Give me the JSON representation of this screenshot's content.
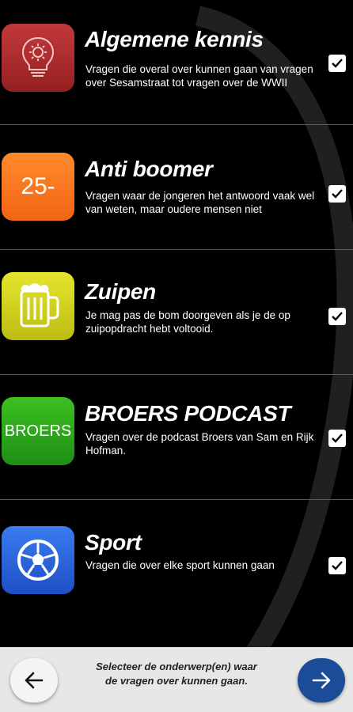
{
  "categories": [
    {
      "title": "Algemene kennis",
      "description": "Vragen die overal over kunnen gaan van vragen over Sesamstraat tot vragen over de WWII",
      "icon": "lightbulb-gear-icon",
      "color": "#b32b2e",
      "checked": true
    },
    {
      "title": "Anti boomer",
      "description": "Vragen waar de jongeren het antwoord vaak wel van weten, maar oudere mensen niet",
      "icon_text": "25-",
      "color": "#f77a1f",
      "checked": true
    },
    {
      "title": "Zuipen",
      "description": "Je mag pas de bom doorgeven als je de op zuipopdracht hebt voltooid.",
      "icon": "beer-mug-icon",
      "color": "#d6d61f",
      "checked": true
    },
    {
      "title": "BROERS PODCAST",
      "description": "Vragen over de podcast Broers van Sam en Rijk Hofman.",
      "icon_text": "BROERS",
      "color": "#2ea81c",
      "checked": true
    },
    {
      "title": "Sport",
      "description": "Vragen die over elke sport kunnen gaan",
      "icon": "soccer-ball-icon",
      "color": "#2b63d9",
      "checked": true
    }
  ],
  "footer": {
    "instruction": "Selecteer de onderwerp(en) waar de vragen over kunnen gaan.",
    "back_icon": "arrow-left-icon",
    "next_icon": "arrow-right-icon"
  }
}
